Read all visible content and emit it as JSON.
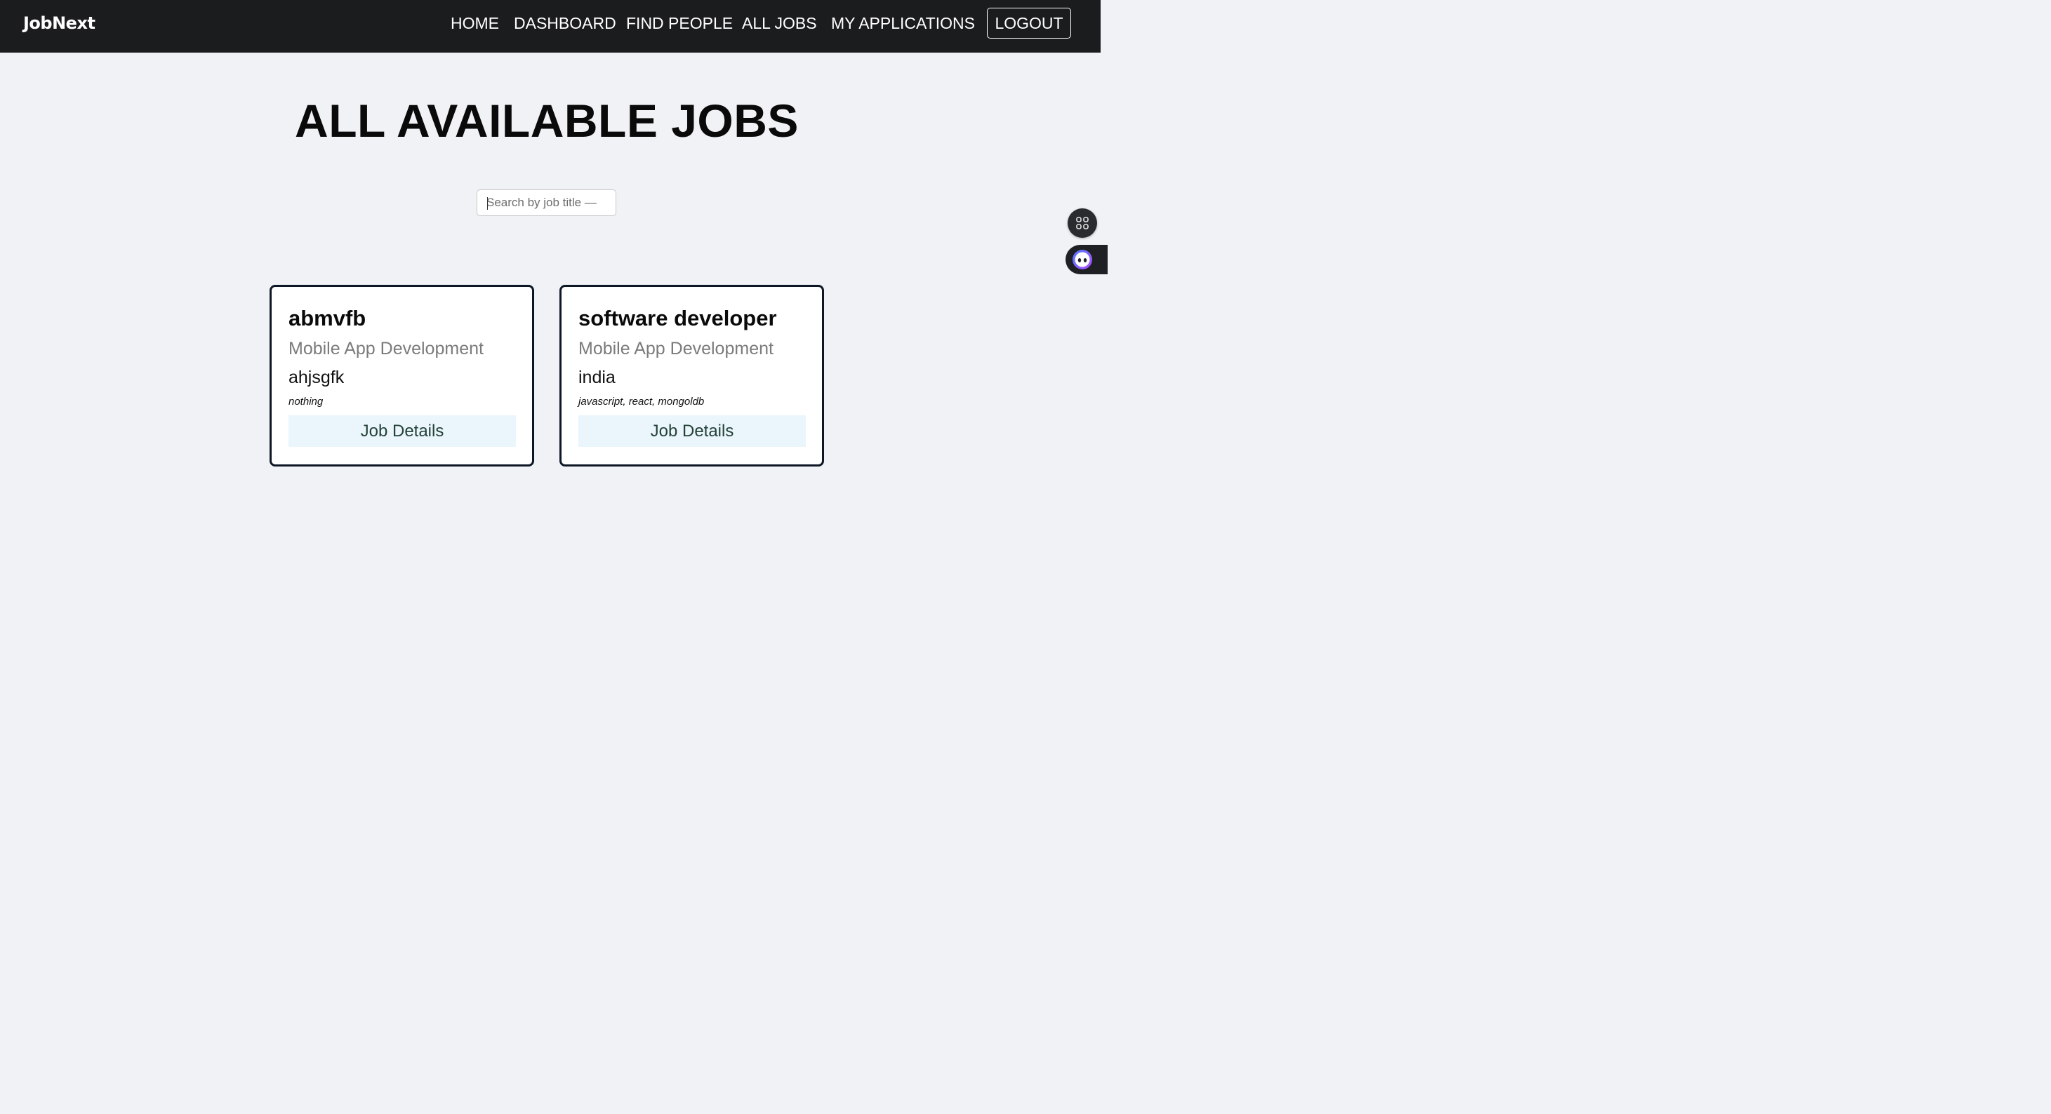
{
  "nav": {
    "brand": "JobNext",
    "links": [
      "HOME",
      "DASHBOARD",
      "FIND PEOPLE",
      "ALL JOBS",
      "MY APPLICATIONS"
    ],
    "logout": "LOGOUT"
  },
  "page": {
    "title": "ALL AVAILABLE JOBS"
  },
  "search": {
    "placeholder": "Search by job title — e",
    "value": ""
  },
  "jobs": [
    {
      "title": "abmvfb",
      "category": "Mobile App Development",
      "location": "ahjsgfk",
      "skills": "nothing",
      "button": "Job Details"
    },
    {
      "title": "software developer",
      "category": "Mobile App Development",
      "location": "india",
      "skills": "javascript, react, mongoldb",
      "button": "Job Details"
    }
  ],
  "floating": {
    "icons": [
      "apps-grid-icon",
      "assistant-bot-icon"
    ]
  }
}
